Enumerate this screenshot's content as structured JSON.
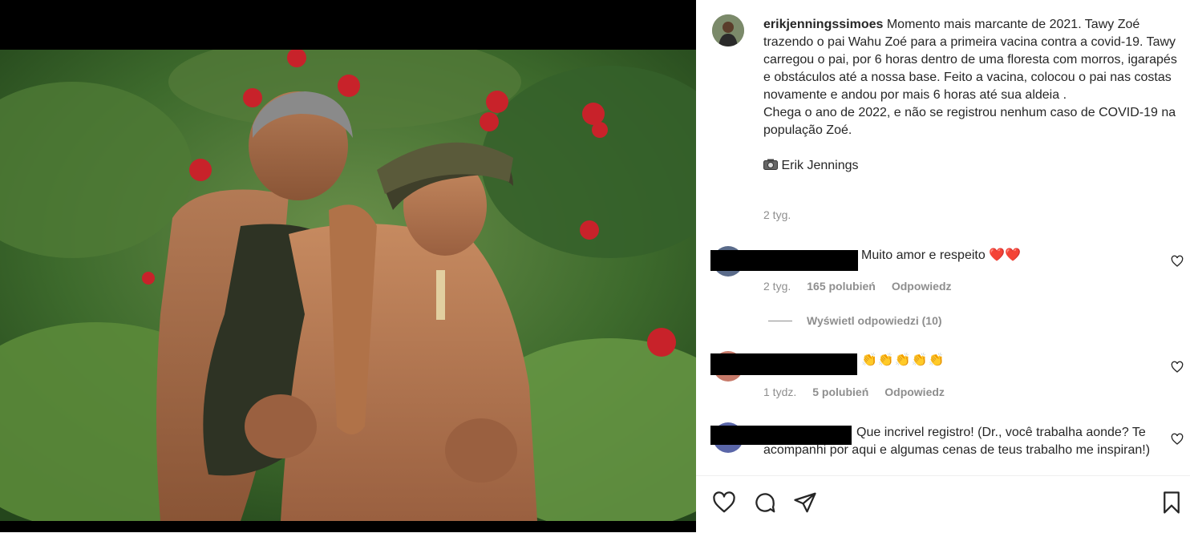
{
  "post": {
    "username": "erikjenningssimoes",
    "caption_lines": [
      "Momento mais marcante de 2021. Tawy Zoé trazendo o pai Wahu Zoé para a primeira vacina contra a covid-19. Tawy carregou o pai, por 6 horas dentro de uma floresta com morros, igarapés e obstáculos até a nossa base. Feito a vacina, colocou o pai nas costas novamente e andou por mais 6 horas até sua aldeia .",
      "Chega o ano de 2022, e não se registrou nenhum caso de COVID-19 na população Zoé."
    ],
    "credit": "Erik Jennings",
    "credit_icon": "camera-icon",
    "age": "2 tyg."
  },
  "comments": [
    {
      "text": "Muito amor e respeito",
      "emoji": "❤️❤️",
      "age": "2 tyg.",
      "likes": "165 polubień",
      "reply_label": "Odpowiedz",
      "view_replies": "Wyświetl odpowiedzi (10)"
    },
    {
      "text": "",
      "emoji": "👏👏👏👏👏",
      "age": "1 tydz.",
      "likes": "5 polubień",
      "reply_label": "Odpowiedz"
    },
    {
      "text": "Que incrivel registro! (Dr., você trabalha aonde? Te acompanhi por aqui e algumas cenas de teus trabalho me inspiran!)"
    }
  ],
  "actions": {
    "like_icon": "heart-icon",
    "comment_icon": "comment-icon",
    "share_icon": "share-icon",
    "save_icon": "bookmark-icon"
  },
  "colors": {
    "text": "#262626",
    "muted": "#8e8e8e",
    "heart_red": "#e0245e",
    "photo_background": "#000000"
  }
}
